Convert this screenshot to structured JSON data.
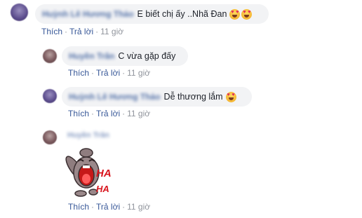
{
  "comments": [
    {
      "author": "Huỳnh Lê Hương Thảo",
      "text": "E biết chị ấy ..Nhã Đan",
      "emoji": [
        "heart-eyes-emoji",
        "heart-eyes-emoji"
      ],
      "actions": {
        "like": "Thích",
        "reply": "Trả lời",
        "time": "11 giờ"
      }
    },
    {
      "author": "Huyền Trân",
      "text": "C vừa gặp đấy",
      "actions": {
        "like": "Thích",
        "reply": "Trả lời",
        "time": "11 giờ"
      }
    },
    {
      "author": "Huỳnh Lê Hương Thảo",
      "text": "Dễ thương lắm",
      "emoji": [
        "heart-eyes-emoji"
      ],
      "actions": {
        "like": "Thích",
        "reply": "Trả lời",
        "time": "11 giờ"
      }
    },
    {
      "author": "Huyền Trân",
      "sticker": {
        "icon": "laughing-rabbit-sticker",
        "text_line1": "HA",
        "text_line2": "HA"
      },
      "actions": {
        "like": "Thích",
        "reply": "Trả lời",
        "time": "11 giờ"
      }
    }
  ]
}
